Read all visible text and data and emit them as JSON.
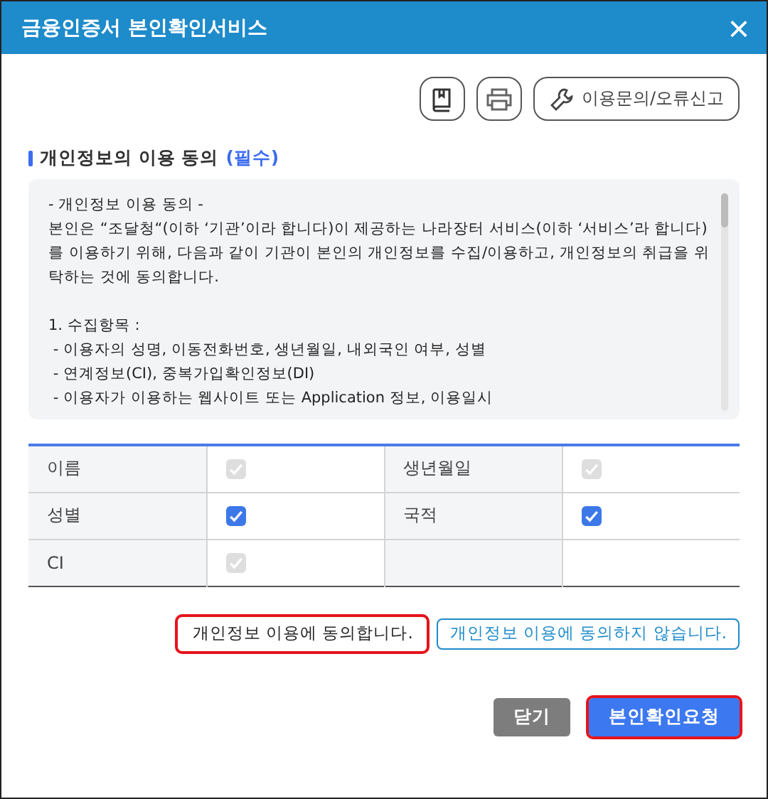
{
  "window": {
    "title": "금융인증서 본인확인서비스",
    "close": "×"
  },
  "toolbar": {
    "help_button": "이용문의/오류신고"
  },
  "section": {
    "title": "개인정보의 이용 동의",
    "required": "(필수)"
  },
  "terms": {
    "paragraphs": [
      [
        "- 개인정보 이용 동의 -",
        "본인은 “조달청“(이하 ‘기관’이라 합니다)이 제공하는 나라장터 서비스(이하 ‘서비스’라 합니다)를 이용하기 위해, 다음과 같이 기관이 본인의 개인정보를 수집/이용하고, 개인정보의 취급을 위탁하는 것에 동의합니다."
      ],
      [
        "1. 수집항목 :",
        " - 이용자의 성명, 이동전화번호, 생년월일, 내외국인 여부, 성별",
        " - 연계정보(CI), 중복가입확인정보(DI)",
        " - 이용자가 이용하는 웹사이트 또는 Application 정보, 이용일시"
      ]
    ]
  },
  "fields": [
    {
      "label": "이름",
      "checked": true,
      "disabled": true
    },
    {
      "label": "생년월일",
      "checked": true,
      "disabled": true
    },
    {
      "label": "성별",
      "checked": true,
      "disabled": false
    },
    {
      "label": "국적",
      "checked": true,
      "disabled": false
    },
    {
      "label": "CI",
      "checked": true,
      "disabled": true
    }
  ],
  "consent_buttons": [
    {
      "label": "개인정보 이용에 동의합니다.",
      "kind": "agree",
      "highlighted": true
    },
    {
      "label": "개인정보 이용에 동의하지 않습니다.",
      "kind": "disagree",
      "highlighted": false
    }
  ],
  "footer_buttons": [
    {
      "label": "닫기",
      "kind": "close",
      "highlighted": false
    },
    {
      "label": "본인확인요청",
      "kind": "primary",
      "highlighted": true
    }
  ]
}
